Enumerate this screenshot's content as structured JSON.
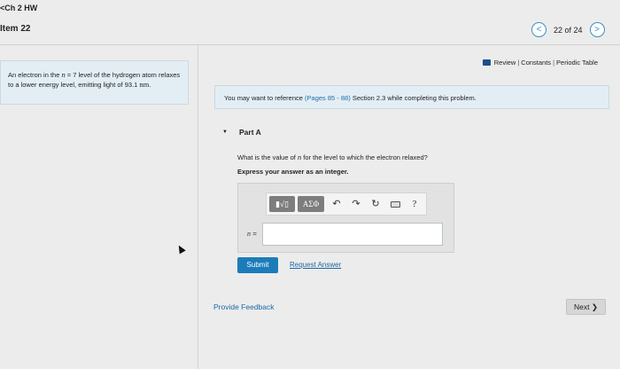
{
  "header": {
    "back_link": "<Ch 2 HW",
    "item_title": "Item 22",
    "pager": {
      "prev": "<",
      "position": "22 of 24",
      "next": ">"
    }
  },
  "problem": {
    "text_a": "An electron in the ",
    "var_n": "n",
    "text_b": " = 7 level of the hydrogen atom relaxes to a lower energy level, emitting light of 93.1 ",
    "unit": "nm",
    "text_c": "."
  },
  "resources": {
    "review": "Review",
    "sep": "|",
    "constants": "Constants",
    "periodic_table": "Periodic Table"
  },
  "reference": {
    "text_a": "You may want to reference ",
    "link": "(Pages 85 - 88)",
    "text_b": " Section 2.3 while completing this problem."
  },
  "part": {
    "toggle": "▼",
    "title": "Part A",
    "question_a": "What is the value of ",
    "question_var": "n",
    "question_b": " for the level to which the electron relaxed?",
    "instruction": "Express your answer as an integer."
  },
  "toolbar": {
    "frac": "▮√▯",
    "greek": "ΑΣΦ",
    "undo": "↶",
    "redo": "↷",
    "reset": "↻",
    "help": "?"
  },
  "answer": {
    "var": "n",
    "eq": " =",
    "value": ""
  },
  "buttons": {
    "submit": "Submit",
    "request_answer": "Request Answer",
    "provide_feedback": "Provide Feedback",
    "next": "Next ❯"
  },
  "colors": {
    "accent": "#1c7cba",
    "panel": "#e3eef4"
  }
}
